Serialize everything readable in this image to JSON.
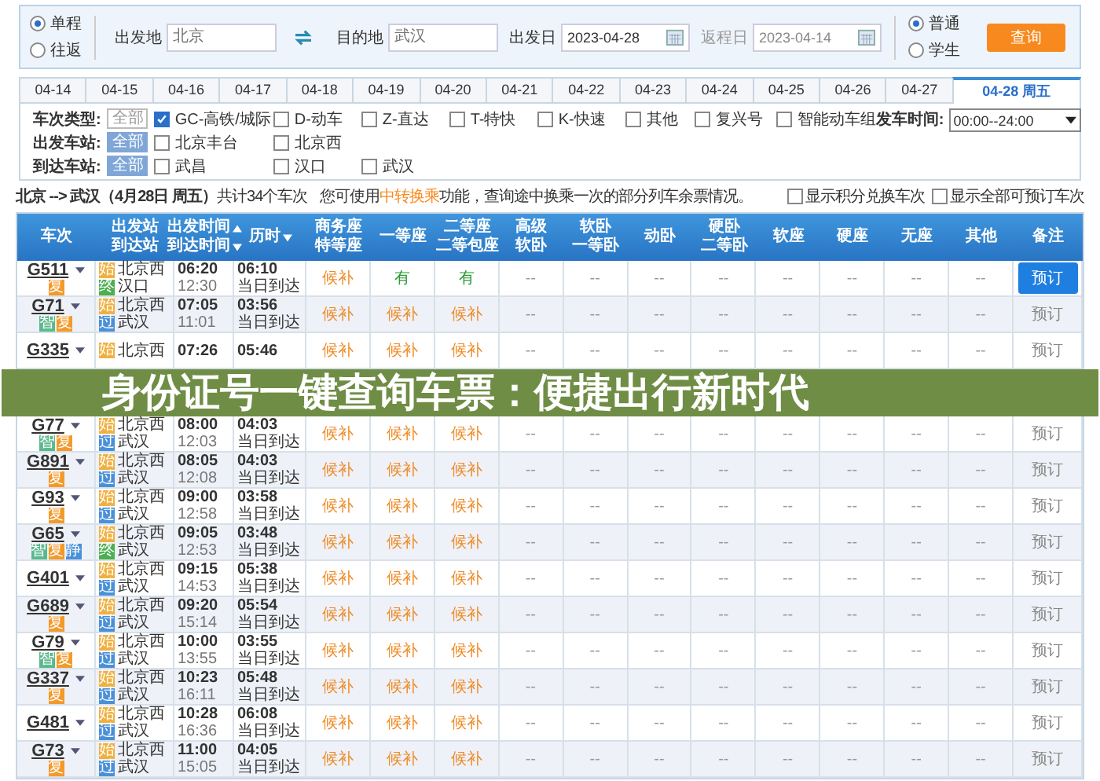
{
  "trip_type": [
    {
      "label": "单程",
      "selected": true
    },
    {
      "label": "往返",
      "selected": false
    }
  ],
  "from": {
    "label": "出发地",
    "placeholder": "北京"
  },
  "to": {
    "label": "目的地",
    "placeholder": "武汉"
  },
  "depart_date": {
    "label": "出发日",
    "value": "2023-04-28",
    "disabled": false
  },
  "return_date": {
    "label": "返程日",
    "value": "2023-04-14",
    "disabled": true
  },
  "passenger_type": [
    {
      "label": "普通",
      "selected": true
    },
    {
      "label": "学生",
      "selected": false
    }
  ],
  "search_button": "查询",
  "date_tabs": [
    {
      "label": "04-14",
      "selected": false
    },
    {
      "label": "04-15",
      "selected": false
    },
    {
      "label": "04-16",
      "selected": false
    },
    {
      "label": "04-17",
      "selected": false
    },
    {
      "label": "04-18",
      "selected": false
    },
    {
      "label": "04-19",
      "selected": false
    },
    {
      "label": "04-20",
      "selected": false
    },
    {
      "label": "04-21",
      "selected": false
    },
    {
      "label": "04-22",
      "selected": false
    },
    {
      "label": "04-23",
      "selected": false
    },
    {
      "label": "04-24",
      "selected": false
    },
    {
      "label": "04-25",
      "selected": false
    },
    {
      "label": "04-26",
      "selected": false
    },
    {
      "label": "04-27",
      "selected": false
    },
    {
      "label": "04-28 周五",
      "selected": true
    }
  ],
  "filters": [
    {
      "label": "车次类型:",
      "all": {
        "label": "全部",
        "selected": false
      },
      "options": [
        {
          "label": "GC-高铁/城际",
          "checked": true
        },
        {
          "label": "D-动车",
          "checked": false
        },
        {
          "label": "Z-直达",
          "checked": false
        },
        {
          "label": "T-特快",
          "checked": false
        },
        {
          "label": "K-快速",
          "checked": false
        },
        {
          "label": "其他",
          "checked": false
        },
        {
          "label": "复兴号",
          "checked": false
        },
        {
          "label": "智能动车组",
          "checked": false
        }
      ]
    },
    {
      "label": "出发车站:",
      "all": {
        "label": "全部",
        "selected": true
      },
      "options": [
        {
          "label": "北京丰台",
          "checked": false
        },
        {
          "label": "北京西",
          "checked": false
        }
      ]
    },
    {
      "label": "到达车站:",
      "all": {
        "label": "全部",
        "selected": true
      },
      "options": [
        {
          "label": "武昌",
          "checked": false
        },
        {
          "label": "汉口",
          "checked": false
        },
        {
          "label": "武汉",
          "checked": false
        }
      ]
    }
  ],
  "depart_time": {
    "label": "发车时间:",
    "value": "00:00--24:00"
  },
  "summary": {
    "route": "北京 --> 武汉（4月28日 周五）",
    "count": "共计34个车次",
    "notice_before": "您可使用",
    "notice_link": "中转换乘",
    "notice_after": "功能，查询途中换乘一次的部分列车余票情况。"
  },
  "options": [
    {
      "label": "显示积分兑换车次",
      "checked": false
    },
    {
      "label": "显示全部可预订车次",
      "checked": false
    }
  ],
  "table": {
    "columns": [
      {
        "lines": [
          "车次"
        ],
        "sortable": false
      },
      {
        "lines": [
          "出发站",
          "到达站"
        ],
        "sortable": false
      },
      {
        "lines": [
          "出发时间",
          "到达时间"
        ],
        "sortable": true
      },
      {
        "lines": [
          "历时"
        ],
        "sortable": true
      },
      {
        "lines": [
          "商务座",
          "特等座"
        ],
        "sortable": false
      },
      {
        "lines": [
          "一等座"
        ],
        "sortable": false
      },
      {
        "lines": [
          "二等座",
          "二等包座"
        ],
        "sortable": false
      },
      {
        "lines": [
          "高级",
          "软卧"
        ],
        "sortable": false
      },
      {
        "lines": [
          "软卧",
          "一等卧"
        ],
        "sortable": false
      },
      {
        "lines": [
          "动卧"
        ],
        "sortable": false
      },
      {
        "lines": [
          "硬卧",
          "二等卧"
        ],
        "sortable": false
      },
      {
        "lines": [
          "软座"
        ],
        "sortable": false
      },
      {
        "lines": [
          "硬座"
        ],
        "sortable": false
      },
      {
        "lines": [
          "无座"
        ],
        "sortable": false
      },
      {
        "lines": [
          "其他"
        ],
        "sortable": false
      },
      {
        "lines": [
          "备注"
        ],
        "sortable": false
      }
    ],
    "rows": [
      {
        "kind": "train",
        "code": "G511",
        "badges": [
          {
            "label": "复",
            "color": "#f39a2b"
          }
        ],
        "from": {
          "name": "北京西",
          "tag": "始",
          "color": "#f0b040"
        },
        "to": {
          "name": "汉口",
          "tag": "终",
          "color": "#4caf50"
        },
        "depart": "06:20",
        "arrive": "12:30",
        "duration": "06:10",
        "arrival_day": "当日到达",
        "seats": [
          "候补",
          "有",
          "有",
          "--",
          "--",
          "--",
          "--",
          "--",
          "--",
          "--",
          "--"
        ],
        "book": "预订",
        "highlighted": true
      },
      {
        "kind": "train",
        "code": "G71",
        "badges": [
          {
            "label": "智",
            "color": "#5bb98c"
          },
          {
            "label": "复",
            "color": "#f39a2b"
          }
        ],
        "from": {
          "name": "北京西",
          "tag": "始",
          "color": "#f0b040"
        },
        "to": {
          "name": "武汉",
          "tag": "过",
          "color": "#4a90d9"
        },
        "depart": "07:05",
        "arrive": "11:01",
        "duration": "03:56",
        "arrival_day": "当日到达",
        "seats": [
          "候补",
          "候补",
          "候补",
          "--",
          "--",
          "--",
          "--",
          "--",
          "--",
          "--",
          "--"
        ],
        "book": "预订",
        "highlighted": false
      },
      {
        "kind": "train",
        "code": "G335",
        "badges": [],
        "from": {
          "name": "北京西",
          "tag": "始",
          "color": "#f0b040"
        },
        "depart": "07:26",
        "duration": "05:46",
        "seats": [
          "候补",
          "候补",
          "候补",
          "--",
          "--",
          "--",
          "--",
          "--",
          "--",
          "--",
          "--"
        ],
        "book": "预订",
        "highlighted": false
      },
      {
        "kind": "banner",
        "title": "身份证号一键查询车票：便捷出行新时代"
      },
      {
        "kind": "train",
        "code": "G77",
        "badges": [
          {
            "label": "智",
            "color": "#5bb98c"
          },
          {
            "label": "复",
            "color": "#f39a2b"
          }
        ],
        "from": {
          "name": "北京西",
          "tag": "始",
          "color": "#f0b040"
        },
        "to": {
          "name": "武汉",
          "tag": "过",
          "color": "#4a90d9"
        },
        "depart": "08:00",
        "arrive": "12:03",
        "duration": "04:03",
        "arrival_day": "当日到达",
        "seats": [
          "候补",
          "候补",
          "候补",
          "--",
          "--",
          "--",
          "--",
          "--",
          "--",
          "--",
          "--"
        ],
        "book": "预订",
        "highlighted": false
      },
      {
        "kind": "train",
        "code": "G891",
        "badges": [
          {
            "label": "复",
            "color": "#f39a2b"
          }
        ],
        "from": {
          "name": "北京西",
          "tag": "始",
          "color": "#f0b040"
        },
        "to": {
          "name": "武汉",
          "tag": "过",
          "color": "#4a90d9"
        },
        "depart": "08:05",
        "arrive": "12:08",
        "duration": "04:03",
        "arrival_day": "当日到达",
        "seats": [
          "候补",
          "候补",
          "候补",
          "--",
          "--",
          "--",
          "--",
          "--",
          "--",
          "--",
          "--"
        ],
        "book": "预订",
        "highlighted": false
      },
      {
        "kind": "train",
        "code": "G93",
        "badges": [
          {
            "label": "复",
            "color": "#f39a2b"
          }
        ],
        "from": {
          "name": "北京西",
          "tag": "始",
          "color": "#f0b040"
        },
        "to": {
          "name": "武汉",
          "tag": "过",
          "color": "#4a90d9"
        },
        "depart": "09:00",
        "arrive": "12:58",
        "duration": "03:58",
        "arrival_day": "当日到达",
        "seats": [
          "候补",
          "候补",
          "候补",
          "--",
          "--",
          "--",
          "--",
          "--",
          "--",
          "--",
          "--"
        ],
        "book": "预订",
        "highlighted": false
      },
      {
        "kind": "train",
        "code": "G65",
        "badges": [
          {
            "label": "智",
            "color": "#5bb98c"
          },
          {
            "label": "复",
            "color": "#f39a2b"
          },
          {
            "label": "静",
            "color": "#4a90d9"
          }
        ],
        "from": {
          "name": "北京西",
          "tag": "始",
          "color": "#f0b040"
        },
        "to": {
          "name": "武汉",
          "tag": "终",
          "color": "#4caf50"
        },
        "depart": "09:05",
        "arrive": "12:53",
        "duration": "03:48",
        "arrival_day": "当日到达",
        "seats": [
          "候补",
          "候补",
          "候补",
          "--",
          "--",
          "--",
          "--",
          "--",
          "--",
          "--",
          "--"
        ],
        "book": "预订",
        "highlighted": false
      },
      {
        "kind": "train",
        "code": "G401",
        "badges": [],
        "from": {
          "name": "北京西",
          "tag": "始",
          "color": "#f0b040"
        },
        "to": {
          "name": "武汉",
          "tag": "过",
          "color": "#4a90d9"
        },
        "depart": "09:15",
        "arrive": "14:53",
        "duration": "05:38",
        "arrival_day": "当日到达",
        "seats": [
          "候补",
          "候补",
          "候补",
          "--",
          "--",
          "--",
          "--",
          "--",
          "--",
          "--",
          "--"
        ],
        "book": "预订",
        "highlighted": false
      },
      {
        "kind": "train",
        "code": "G689",
        "badges": [
          {
            "label": "复",
            "color": "#f39a2b"
          }
        ],
        "from": {
          "name": "北京西",
          "tag": "始",
          "color": "#f0b040"
        },
        "to": {
          "name": "武汉",
          "tag": "过",
          "color": "#4a90d9"
        },
        "depart": "09:20",
        "arrive": "15:14",
        "duration": "05:54",
        "arrival_day": "当日到达",
        "seats": [
          "候补",
          "候补",
          "候补",
          "--",
          "--",
          "--",
          "--",
          "--",
          "--",
          "--",
          "--"
        ],
        "book": "预订",
        "highlighted": false
      },
      {
        "kind": "train",
        "code": "G79",
        "badges": [
          {
            "label": "智",
            "color": "#5bb98c"
          },
          {
            "label": "复",
            "color": "#f39a2b"
          }
        ],
        "from": {
          "name": "北京西",
          "tag": "始",
          "color": "#f0b040"
        },
        "to": {
          "name": "武汉",
          "tag": "过",
          "color": "#4a90d9"
        },
        "depart": "10:00",
        "arrive": "13:55",
        "duration": "03:55",
        "arrival_day": "当日到达",
        "seats": [
          "候补",
          "候补",
          "候补",
          "--",
          "--",
          "--",
          "--",
          "--",
          "--",
          "--",
          "--"
        ],
        "book": "预订",
        "highlighted": false
      },
      {
        "kind": "train",
        "code": "G337",
        "badges": [
          {
            "label": "复",
            "color": "#f39a2b"
          }
        ],
        "from": {
          "name": "北京西",
          "tag": "始",
          "color": "#f0b040"
        },
        "to": {
          "name": "武汉",
          "tag": "过",
          "color": "#4a90d9"
        },
        "depart": "10:23",
        "arrive": "16:11",
        "duration": "05:48",
        "arrival_day": "当日到达",
        "seats": [
          "候补",
          "候补",
          "候补",
          "--",
          "--",
          "--",
          "--",
          "--",
          "--",
          "--",
          "--"
        ],
        "book": "预订",
        "highlighted": false
      },
      {
        "kind": "train",
        "code": "G481",
        "badges": [],
        "from": {
          "name": "北京西",
          "tag": "始",
          "color": "#f0b040"
        },
        "to": {
          "name": "武汉",
          "tag": "过",
          "color": "#4a90d9"
        },
        "depart": "10:28",
        "arrive": "16:36",
        "duration": "06:08",
        "arrival_day": "当日到达",
        "seats": [
          "候补",
          "候补",
          "候补",
          "--",
          "--",
          "--",
          "--",
          "--",
          "--",
          "--",
          "--"
        ],
        "book": "预订",
        "highlighted": false
      },
      {
        "kind": "train",
        "code": "G73",
        "badges": [
          {
            "label": "复",
            "color": "#f39a2b"
          }
        ],
        "from": {
          "name": "北京西",
          "tag": "始",
          "color": "#f0b040"
        },
        "to": {
          "name": "武汉",
          "tag": "过",
          "color": "#4a90d9"
        },
        "depart": "11:00",
        "arrive": "15:05",
        "duration": "04:05",
        "arrival_day": "当日到达",
        "seats": [
          "候补",
          "候补",
          "候补",
          "--",
          "--",
          "--",
          "--",
          "--",
          "--",
          "--",
          "--"
        ],
        "book": "预订",
        "highlighted": false
      }
    ]
  }
}
